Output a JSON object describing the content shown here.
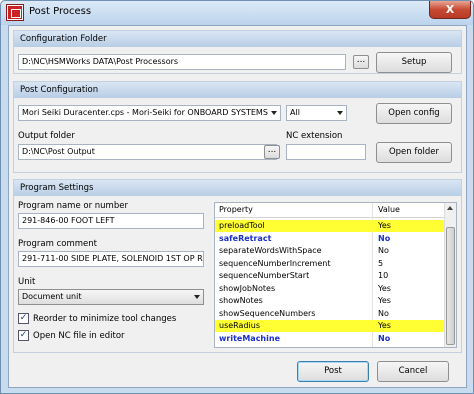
{
  "window": {
    "title": "Post Process",
    "close_glyph": "X"
  },
  "config_folder": {
    "header": "Configuration Folder",
    "path": "D:\\NC\\HSMWorks DATA\\Post Processors",
    "browse_label": "...",
    "setup_label": "Setup"
  },
  "post_config": {
    "header": "Post Configuration",
    "post_selected": "Mori Seiki Duracenter.cps - Mori-Seiki for ONBOARD SYSTEMS",
    "filter_selected": "All",
    "open_config_label": "Open config",
    "output_folder_label": "Output folder",
    "output_folder": "D:\\NC\\Post Output",
    "browse_label": "...",
    "nc_extension_label": "NC extension",
    "nc_extension": "",
    "open_folder_label": "Open folder"
  },
  "program_settings": {
    "header": "Program Settings",
    "name_label": "Program name or number",
    "name_value": "291-846-00 FOOT LEFT",
    "comment_label": "Program comment",
    "comment_value": "291-711-00 SIDE PLATE, SOLENOID 1ST OP R7",
    "unit_label": "Unit",
    "unit_selected": "Document unit",
    "reorder_label": "Reorder to minimize tool changes",
    "reorder_checked": true,
    "open_nc_label": "Open NC file in editor",
    "open_nc_checked": true,
    "check_glyph": "✓"
  },
  "properties": {
    "col_property": "Property",
    "col_value": "Value",
    "rows": [
      {
        "name": "preloadTool",
        "value": "Yes",
        "highlight": true,
        "bold": false
      },
      {
        "name": "safeRetract",
        "value": "No",
        "highlight": false,
        "bold": true
      },
      {
        "name": "separateWordsWithSpace",
        "value": "No",
        "highlight": false,
        "bold": false
      },
      {
        "name": "sequenceNumberIncrement",
        "value": "5",
        "highlight": false,
        "bold": false
      },
      {
        "name": "sequenceNumberStart",
        "value": "10",
        "highlight": false,
        "bold": false
      },
      {
        "name": "showJobNotes",
        "value": "Yes",
        "highlight": false,
        "bold": false
      },
      {
        "name": "showNotes",
        "value": "Yes",
        "highlight": false,
        "bold": false
      },
      {
        "name": "showSequenceNumbers",
        "value": "No",
        "highlight": false,
        "bold": false
      },
      {
        "name": "useRadius",
        "value": "Yes",
        "highlight": true,
        "bold": false
      },
      {
        "name": "writeMachine",
        "value": "No",
        "highlight": false,
        "bold": true
      }
    ]
  },
  "footer": {
    "post_label": "Post",
    "cancel_label": "Cancel"
  },
  "colors": {
    "highlight": "#ffff33",
    "bold_text": "#1a2fc8",
    "title_close": "#c74a34"
  }
}
